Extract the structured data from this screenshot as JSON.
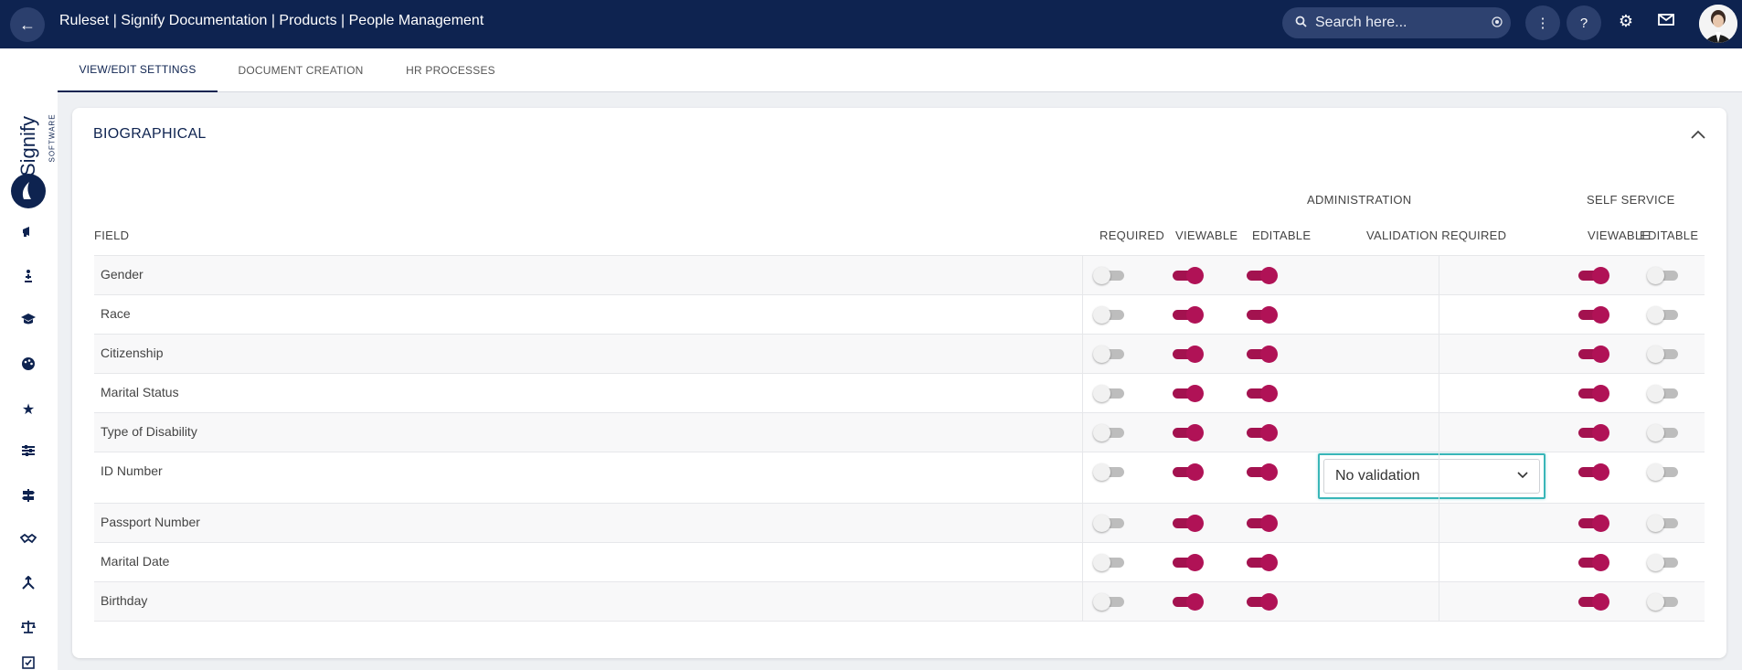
{
  "header": {
    "back_icon": "arrow-left-icon",
    "title": "Ruleset | Signify Documentation | Products | People Management",
    "search_placeholder": "Search here...",
    "actions": [
      "more-vertical-icon",
      "help-icon",
      "gear-icon",
      "mail-icon"
    ]
  },
  "logo": {
    "brand": "Signify",
    "sub": "SOFTWARE"
  },
  "sidebar": {
    "icons": [
      "megaphone-icon",
      "person-walking-icon",
      "graduation-cap-icon",
      "palette-icon",
      "star-icon",
      "sliders-icon",
      "signpost-icon",
      "handshake-icon",
      "route-icon",
      "scales-icon",
      "checklist-icon"
    ]
  },
  "tabs": [
    {
      "label": "VIEW/EDIT SETTINGS",
      "active": true
    },
    {
      "label": "DOCUMENT CREATION",
      "active": false
    },
    {
      "label": "HR PROCESSES",
      "active": false
    }
  ],
  "section": {
    "title": "BIOGRAPHICAL",
    "group_headers": {
      "administration": "ADMINISTRATION",
      "self_service": "SELF SERVICE"
    },
    "columns": {
      "field": "FIELD",
      "required": "REQUIRED",
      "viewable": "VIEWABLE",
      "editable": "EDITABLE",
      "validation_required": "VALIDATION REQUIRED",
      "ss_viewable": "VIEWABLE",
      "ss_editable": "EDITABLE"
    },
    "rows": [
      {
        "label": "Gender",
        "required": false,
        "viewable": true,
        "editable": true,
        "ss_viewable": true,
        "ss_editable": false
      },
      {
        "label": "Race",
        "required": false,
        "viewable": true,
        "editable": true,
        "ss_viewable": true,
        "ss_editable": false
      },
      {
        "label": "Citizenship",
        "required": false,
        "viewable": true,
        "editable": true,
        "ss_viewable": true,
        "ss_editable": false
      },
      {
        "label": "Marital Status",
        "required": false,
        "viewable": true,
        "editable": true,
        "ss_viewable": true,
        "ss_editable": false
      },
      {
        "label": "Type of Disability",
        "required": false,
        "viewable": true,
        "editable": true,
        "ss_viewable": true,
        "ss_editable": false
      },
      {
        "label": "ID Number",
        "required": false,
        "viewable": true,
        "editable": true,
        "ss_viewable": true,
        "ss_editable": false,
        "validation": "No validation"
      },
      {
        "label": "Passport Number",
        "required": false,
        "viewable": true,
        "editable": true,
        "ss_viewable": true,
        "ss_editable": false
      },
      {
        "label": "Marital Date",
        "required": false,
        "viewable": true,
        "editable": true,
        "ss_viewable": true,
        "ss_editable": false
      },
      {
        "label": "Birthday",
        "required": false,
        "viewable": true,
        "editable": true,
        "ss_viewable": true,
        "ss_editable": false
      }
    ]
  },
  "colors": {
    "header_bg": "#0e2350",
    "toggle_on": "#b01256",
    "focus_ring": "#39b6b8"
  }
}
